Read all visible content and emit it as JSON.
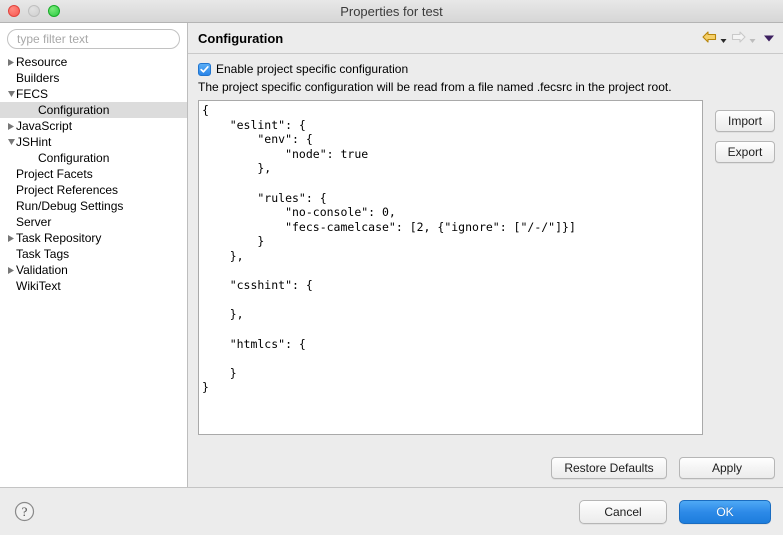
{
  "window": {
    "title": "Properties for test",
    "controls": {
      "close": "close-button",
      "minimize": "minimize-button",
      "zoom": "zoom-button"
    }
  },
  "sidebar": {
    "filter": {
      "placeholder": "type filter text",
      "value": ""
    },
    "items": [
      {
        "label": "Resource",
        "indent": 0,
        "twisty": "collapsed",
        "selected": false
      },
      {
        "label": "Builders",
        "indent": 0,
        "twisty": "none",
        "selected": false
      },
      {
        "label": "FECS",
        "indent": 0,
        "twisty": "expanded",
        "selected": false
      },
      {
        "label": "Configuration",
        "indent": 1,
        "twisty": "none",
        "selected": true
      },
      {
        "label": "JavaScript",
        "indent": 0,
        "twisty": "collapsed",
        "selected": false
      },
      {
        "label": "JSHint",
        "indent": 0,
        "twisty": "expanded",
        "selected": false
      },
      {
        "label": "Configuration",
        "indent": 1,
        "twisty": "none",
        "selected": false
      },
      {
        "label": "Project Facets",
        "indent": 0,
        "twisty": "none",
        "selected": false
      },
      {
        "label": "Project References",
        "indent": 0,
        "twisty": "none",
        "selected": false
      },
      {
        "label": "Run/Debug Settings",
        "indent": 0,
        "twisty": "none",
        "selected": false
      },
      {
        "label": "Server",
        "indent": 0,
        "twisty": "none",
        "selected": false
      },
      {
        "label": "Task Repository",
        "indent": 0,
        "twisty": "collapsed",
        "selected": false
      },
      {
        "label": "Task Tags",
        "indent": 0,
        "twisty": "none",
        "selected": false
      },
      {
        "label": "Validation",
        "indent": 0,
        "twisty": "collapsed",
        "selected": false
      },
      {
        "label": "WikiText",
        "indent": 0,
        "twisty": "none",
        "selected": false
      }
    ]
  },
  "pane": {
    "title": "Configuration",
    "nav": {
      "back_icon": "back-arrow-icon",
      "back_menu_icon": "chevron-down-icon",
      "forward_icon": "forward-arrow-icon",
      "forward_menu_icon": "chevron-down-icon",
      "menu_icon": "chevron-down-icon"
    },
    "checkbox": {
      "label": "Enable project specific configuration",
      "checked": true,
      "icon": "checkmark-icon"
    },
    "description": "The project specific configuration will be read from a file named .fecsrc in the project root.",
    "code": "{\n    \"eslint\": {\n        \"env\": {\n            \"node\": true\n        },\n\n        \"rules\": {\n            \"no-console\": 0,\n            \"fecs-camelcase\": [2, {\"ignore\": [\"/-/\"]}]\n        }\n    },\n\n    \"csshint\": {\n\n    },\n\n    \"htmlcs\": {\n\n    }\n}",
    "buttons": {
      "import": "Import",
      "export": "Export",
      "restore_defaults": "Restore Defaults",
      "apply": "Apply"
    }
  },
  "footer": {
    "help_icon": "help-question-icon",
    "cancel": "Cancel",
    "ok": "OK"
  },
  "colors": {
    "accent_blue": "#2d8ae8",
    "checkbox_blue": "#2a84e8",
    "back_arrow": "#f2c14e",
    "forward_arrow": "#e8e8e8",
    "menu_caret": "#4b2a6e",
    "window_bg": "#ececec",
    "selection_grey": "#dcdcdc"
  }
}
